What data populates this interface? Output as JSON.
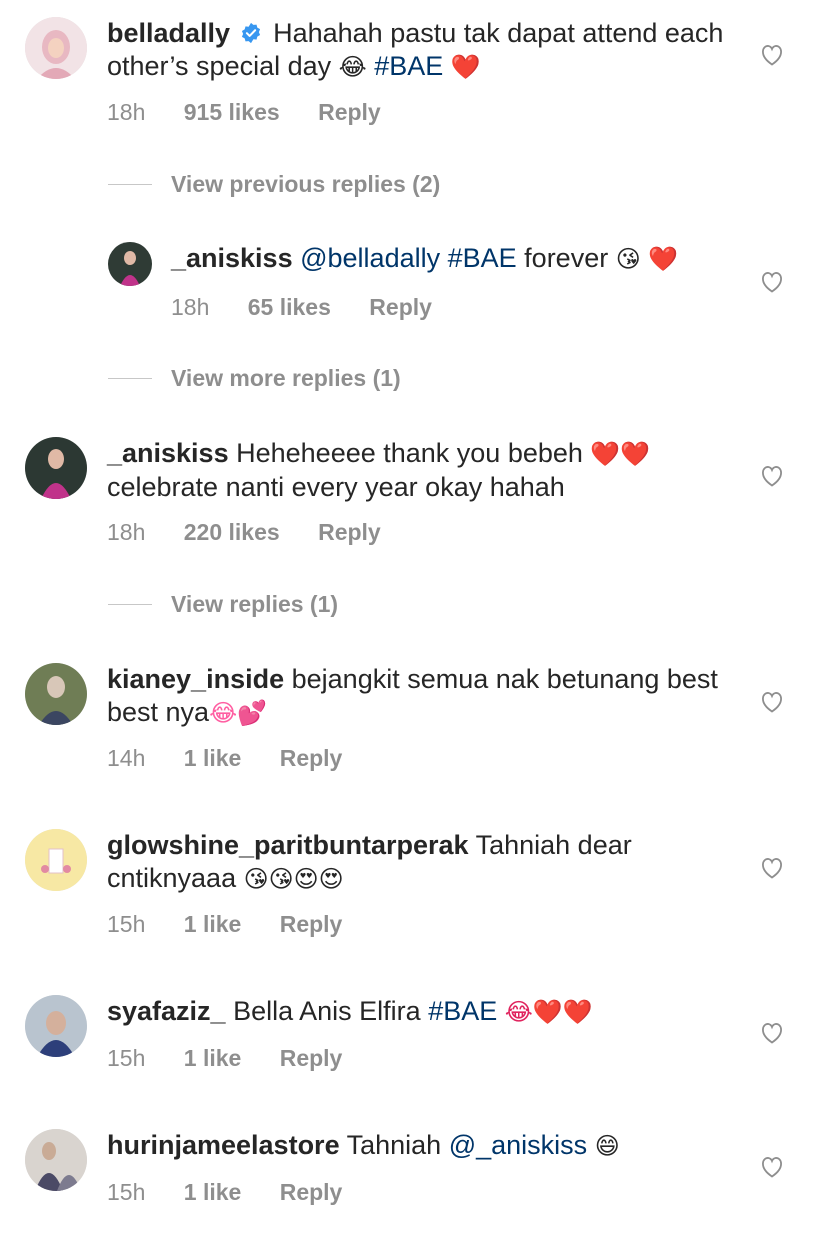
{
  "comments": [
    {
      "username": "belladally",
      "verified": true,
      "text": "Hahahah pastu tak dapat attend each other’s special day",
      "emojis_a": "😂",
      "tag": "#BAE",
      "emojis_b": "❤️",
      "time": "18h",
      "likes": "915 likes",
      "reply": "Reply"
    },
    {
      "username": "_aniskiss",
      "mention": "@belladally",
      "tag": "#BAE",
      "text": "forever",
      "emojis_a": "😘",
      "emojis_b": "❤️",
      "time": "18h",
      "likes": "65 likes",
      "reply": "Reply"
    },
    {
      "username": "_aniskiss",
      "text": "Heheheeee thank you bebeh",
      "emojis_a": "❤️❤️",
      "text2": "celebrate nanti every year okay hahah",
      "time": "18h",
      "likes": "220 likes",
      "reply": "Reply"
    },
    {
      "username": "kianey_inside",
      "text": "bejangkit semua nak betunang best best nya",
      "emojis_a": "😂💕",
      "time": "14h",
      "likes": "1 like",
      "reply": "Reply"
    },
    {
      "username": "glowshine_paritbuntarperak",
      "text": "Tahniah dear cntiknyaaa",
      "emojis_a": "😘😘😍😍",
      "time": "15h",
      "likes": "1 like",
      "reply": "Reply"
    },
    {
      "username": "syafaziz_",
      "text": "Bella Anis Elfira",
      "tag": "#BAE",
      "emojis_a": "😂❤️❤️",
      "time": "15h",
      "likes": "1 like",
      "reply": "Reply"
    },
    {
      "username": "hurinjameelastore",
      "text": "Tahniah",
      "mention": "@_aniskiss",
      "emojis_a": "😄",
      "time": "15h",
      "likes": "1 like",
      "reply": "Reply"
    }
  ],
  "threads": {
    "view_previous": "View previous replies (2)",
    "view_more": "View more replies (1)",
    "view_replies": "View replies (1)"
  },
  "icons": {
    "like": "heart-outline-icon",
    "verified": "verified-badge-icon"
  },
  "colors": {
    "text": "#262626",
    "meta": "#8e8e8e",
    "link": "#003569",
    "verified": "#3897f0"
  }
}
